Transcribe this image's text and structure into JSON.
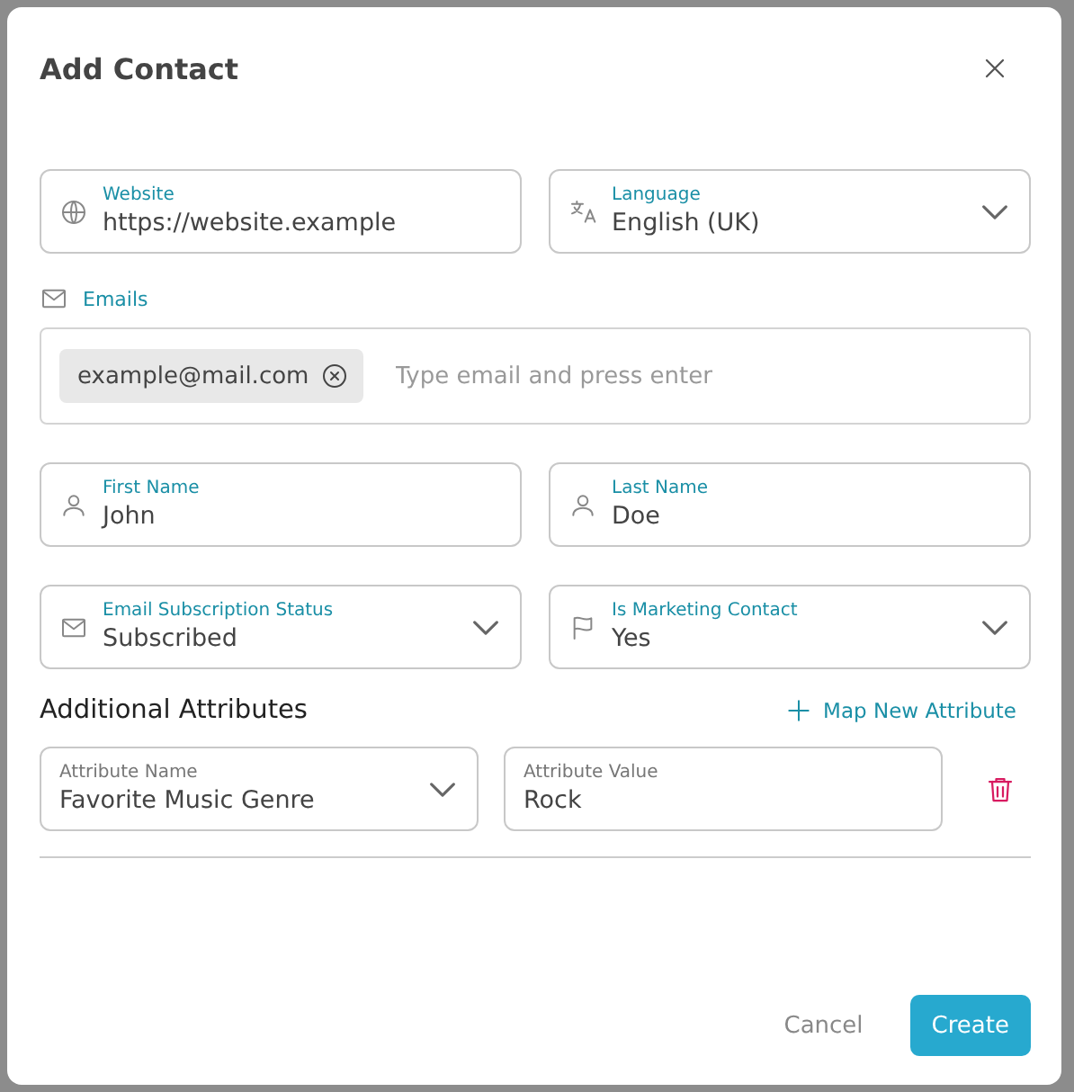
{
  "dialog": {
    "title": "Add Contact"
  },
  "top_fields": [
    {
      "kind": "input",
      "label": "Website",
      "value": "https://website.example"
    },
    {
      "kind": "select",
      "label": "Language",
      "value": "English (UK)"
    }
  ],
  "emails": {
    "label": "Emails",
    "chips": [
      "example@mail.com"
    ],
    "placeholder": "Type email and press enter"
  },
  "name_fields": [
    {
      "kind": "input",
      "label": "First Name",
      "value": "John"
    },
    {
      "kind": "input",
      "label": "Last Name",
      "value": "Doe"
    }
  ],
  "status_fields": [
    {
      "kind": "select",
      "label": "Email Subscription Status",
      "value": "Subscribed"
    },
    {
      "kind": "select",
      "label": "Is Marketing Contact",
      "value": "Yes"
    }
  ],
  "additional_attributes": {
    "title": "Additional Attributes",
    "add_button": "Map New Attribute",
    "rows": [
      {
        "name_label": "Attribute Name",
        "name_value": "Favorite Music Genre",
        "value_label": "Attribute Value",
        "value": "Rock"
      }
    ]
  },
  "buttons": {
    "cancel": "Cancel",
    "create": "Create"
  }
}
